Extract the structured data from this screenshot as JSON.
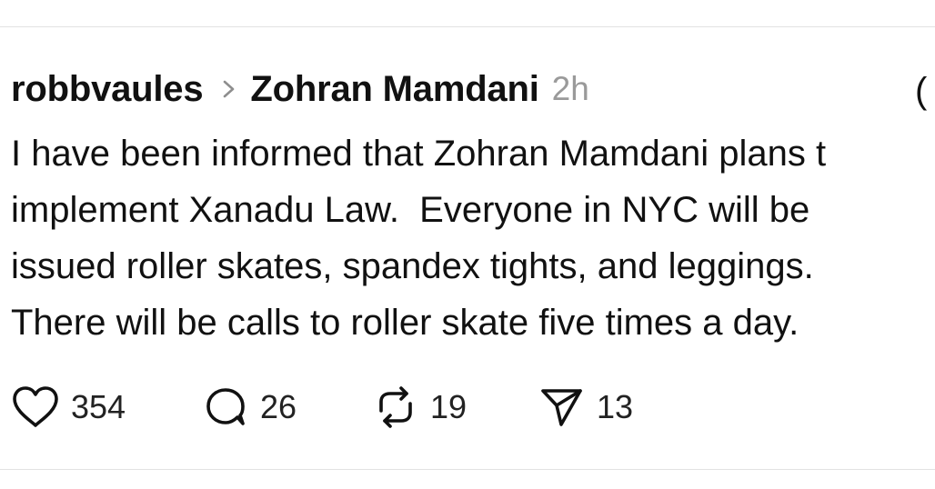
{
  "post": {
    "username": "robbvaules",
    "reply_to": "Zohran Mamdani",
    "time": "2h",
    "more_glyph": "(",
    "body_lines": [
      "I have been informed that Zohran Mamdani plans t",
      "implement Xanadu Law.  Everyone in NYC will be",
      "issued roller skates, spandex tights, and leggings.",
      "There will be calls to roller skate five times a day."
    ]
  },
  "actions": {
    "like": {
      "icon": "heart-icon",
      "count": "354"
    },
    "comment": {
      "icon": "comment-icon",
      "count": "26"
    },
    "repost": {
      "icon": "repost-icon",
      "count": "19"
    },
    "share": {
      "icon": "send-icon",
      "count": "13"
    }
  }
}
